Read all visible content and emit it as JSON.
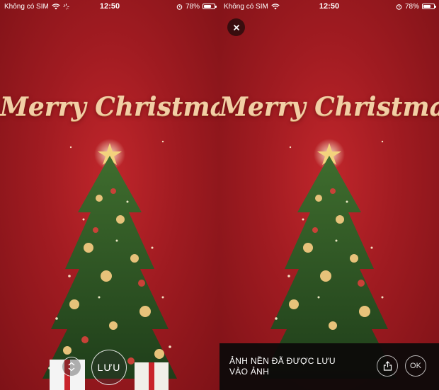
{
  "status_bar": {
    "carrier": "Không có SIM",
    "time": "12:50",
    "battery": "78%",
    "battery_level": 0.78,
    "icons": [
      "wifi-icon",
      "loading-icon",
      "alarm-icon",
      "battery-icon"
    ]
  },
  "wallpaper": {
    "greeting": "Merry Christmas !",
    "colors": {
      "background": "#a01b21",
      "text_gold": "#f2cfa6"
    }
  },
  "left_screen": {
    "motion_toggle_icon": "chevron-up-down-icon",
    "save_label": "LƯU"
  },
  "right_screen": {
    "close_icon": "close-icon",
    "toast": {
      "line1": "ẢNH NỀN ĐÃ ĐƯỢC LƯU",
      "line2": "VÀO ẢNH",
      "share_icon": "share-icon",
      "ok_label": "OK"
    }
  }
}
